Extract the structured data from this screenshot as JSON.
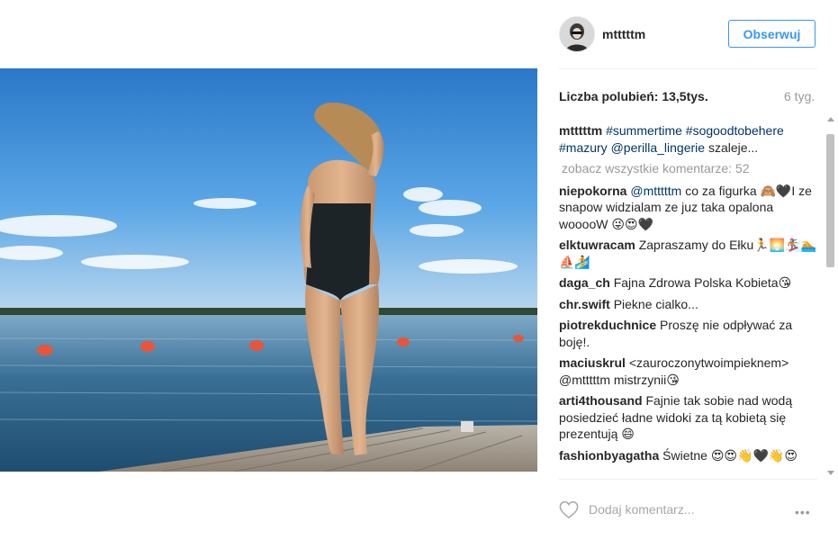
{
  "post": {
    "username": "mtttttm",
    "follow_label": "Obserwuj",
    "likes_label": "Liczba polubień: 13,5tys.",
    "age": "6 tyg."
  },
  "caption": {
    "user": "mtttttm",
    "tags": "#summertime #sogoodtobehere #mazury @perilla_lingerie",
    "text": "szaleje..."
  },
  "view_all": "zobacz wszystkie komentarze: 52",
  "comments": [
    {
      "user": "niepokorna",
      "mention": "@mtttttm",
      "text": "co za figurka 🙈🖤I ze snapow widzialam ze juz taka opalona wooooW 😜😍🖤"
    },
    {
      "user": "elktuwracam",
      "mention": "",
      "text": "Zapraszamy do Ełku🏃🌅🏂🏊⛵🏄"
    },
    {
      "user": "daga_ch",
      "mention": "",
      "text": "Fajna Zdrowa Polska Kobieta😘"
    },
    {
      "user": "chr.swift",
      "mention": "",
      "text": "Piekne cialko..."
    },
    {
      "user": "piotrekduchnice",
      "mention": "",
      "text": "Proszę nie odpływać za boję!."
    },
    {
      "user": "maciuskrul",
      "mention": "",
      "text": "<zauroczonytwoimpieknem> @mtttttm mistrzynii😘"
    },
    {
      "user": "arti4thousand",
      "mention": "",
      "text": "Fajnie tak sobie nad wodą posiedzieć ładne widoki za tą kobietą się prezentują 😄"
    },
    {
      "user": "fashionbyagatha",
      "mention": "",
      "text": "Świetne 😍😍👋🖤👋😍"
    }
  ],
  "add_comment_placeholder": "Dodaj komentarz...",
  "more_label": "•••",
  "icons": {
    "like": "heart-icon",
    "more": "more-options-icon"
  }
}
